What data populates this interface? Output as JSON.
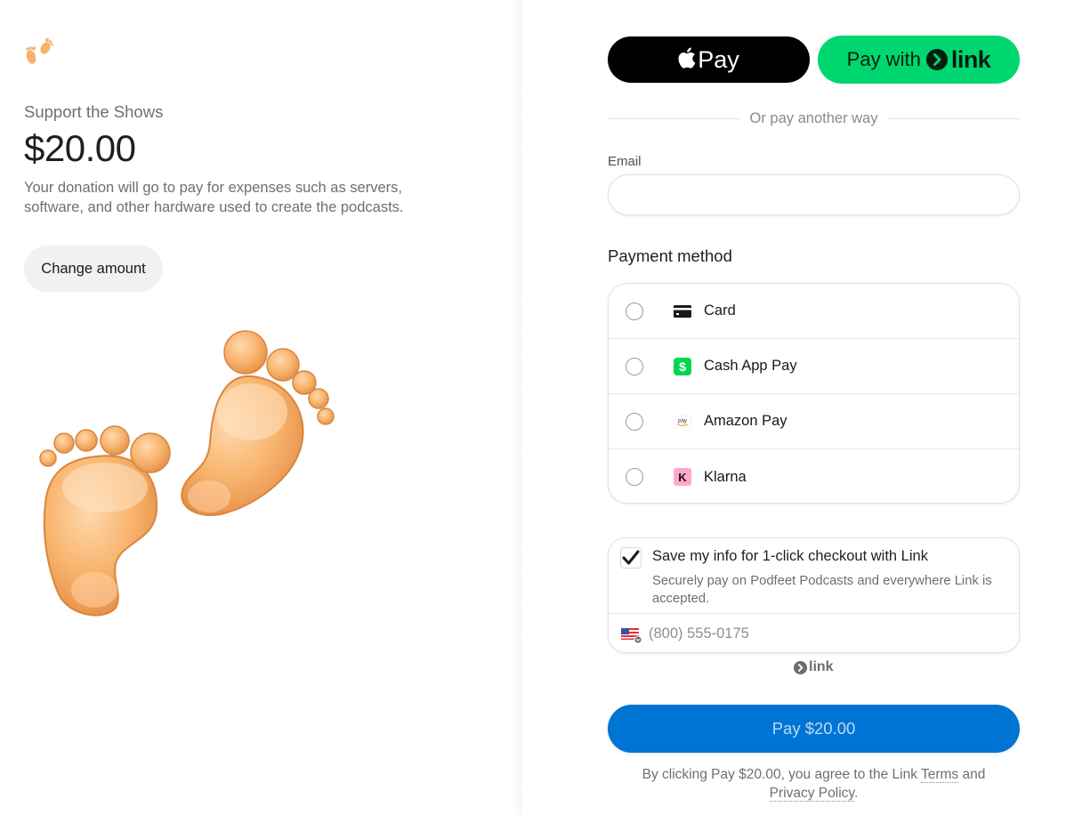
{
  "merchant": {
    "logo_icon": "footprints-icon"
  },
  "product": {
    "name": "Support the Shows",
    "price": "$20.00",
    "description": "Your donation will go to pay for expenses such as servers, software, and other hardware used to create the podcasts.",
    "change_amount_label": "Change amount",
    "image_icon": "footprints-illustration"
  },
  "express": {
    "apple_pay_label": "Pay",
    "link_pay_prefix": "Pay with",
    "link_word": "link",
    "divider_text": "Or pay another way"
  },
  "email": {
    "label": "Email",
    "value": "",
    "placeholder": ""
  },
  "payment_method": {
    "title": "Payment method",
    "options": [
      {
        "label": "Card",
        "icon": "credit-card-icon",
        "selected": false
      },
      {
        "label": "Cash App Pay",
        "icon": "cash-app-icon",
        "selected": false
      },
      {
        "label": "Amazon Pay",
        "icon": "amazon-pay-icon",
        "selected": false
      },
      {
        "label": "Klarna",
        "icon": "klarna-icon",
        "selected": false
      }
    ]
  },
  "save_info": {
    "checked": true,
    "title": "Save my info for 1-click checkout with Link",
    "subtitle": "Securely pay on Podfeet Podcasts and everywhere Link is accepted.",
    "phone_placeholder": "(800) 555-0175",
    "country_flag": "us-flag-icon",
    "link_badge": "link"
  },
  "pay_button": {
    "label": "Pay $20.00"
  },
  "terms": {
    "prefix": "By clicking Pay $20.00, you agree to the Link ",
    "terms_link": "Terms",
    "middle": " and ",
    "privacy_link": "Privacy Policy",
    "suffix": "."
  },
  "colors": {
    "link_green": "#00d66f",
    "pay_blue": "#0074d4",
    "apple_black": "#000000",
    "cash_app_green": "#00d64f",
    "klarna_pink": "#ffa8cd"
  }
}
